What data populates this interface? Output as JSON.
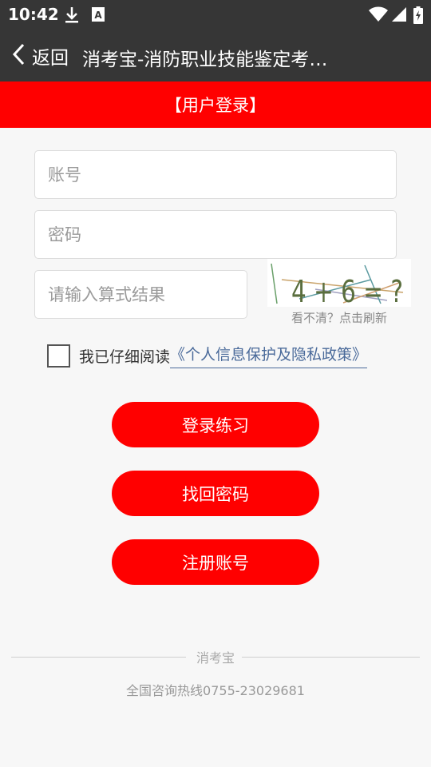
{
  "status_bar": {
    "time": "10:42",
    "icons_left": [
      "download-icon",
      "font-a-icon"
    ],
    "icons_right": [
      "wifi-icon",
      "cellular-signal-icon",
      "battery-charging-icon"
    ]
  },
  "header": {
    "back_label": "返回",
    "title": "消考宝-消防职业技能鉴定考试题库",
    "bar_color": "#363636"
  },
  "banner": {
    "text": "【用户登录】",
    "color": "#ff0000"
  },
  "form": {
    "account_placeholder": "账号",
    "password_placeholder": "密码",
    "captcha_placeholder": "请输入算式结果",
    "captcha_image_text": "4 + 6 = ?",
    "captcha_hint": "看不清？点击刷新",
    "agree_prefix": "我已仔细阅读",
    "policy_link": "《个人信息保护及隐私政策》",
    "agree_checked": false
  },
  "buttons": {
    "login": "登录练习",
    "recover": "找回密码",
    "register": "注册账号"
  },
  "footer": {
    "brand": "消考宝",
    "hotline": "全国咨询热线0755-23029681"
  }
}
